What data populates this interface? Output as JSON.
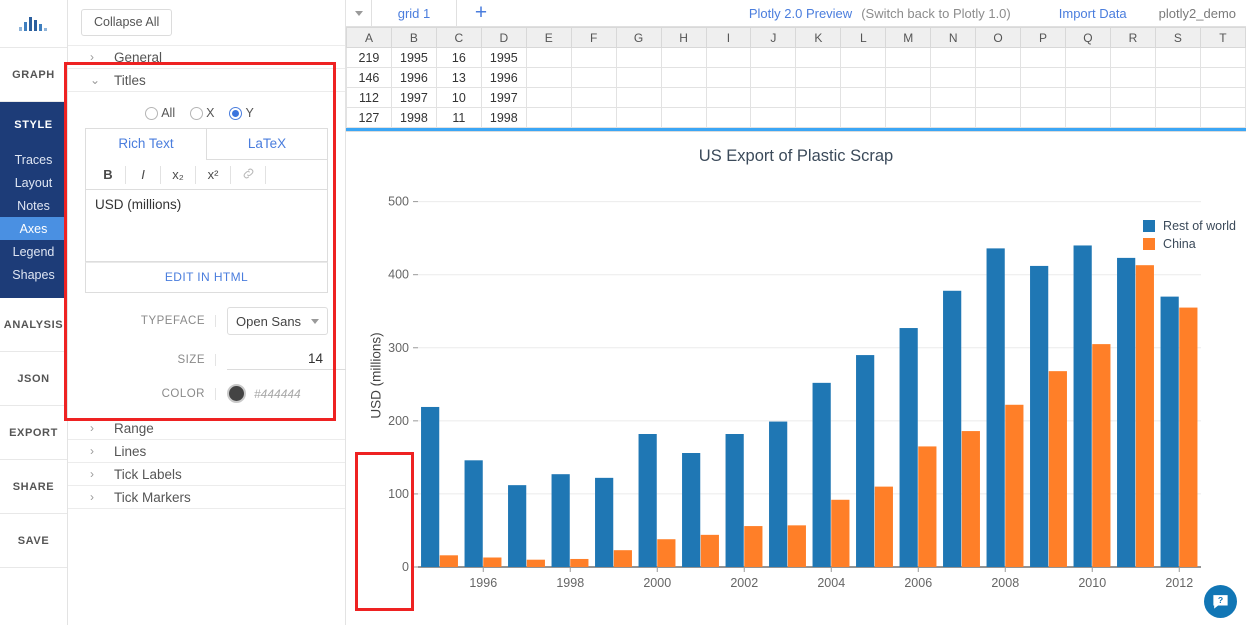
{
  "rail": {
    "logo_icon": "bar-chart-logo-icon",
    "sections": [
      {
        "label": "GRAPH"
      },
      {
        "label": "STYLE"
      },
      {
        "label": "ANALYSIS"
      },
      {
        "label": "JSON"
      },
      {
        "label": "EXPORT"
      },
      {
        "label": "SHARE"
      },
      {
        "label": "SAVE"
      }
    ],
    "style_items": [
      {
        "label": "Traces",
        "active": false
      },
      {
        "label": "Layout",
        "active": false
      },
      {
        "label": "Notes",
        "active": false
      },
      {
        "label": "Axes",
        "active": true
      },
      {
        "label": "Legend",
        "active": false
      },
      {
        "label": "Shapes",
        "active": false
      }
    ]
  },
  "panel": {
    "collapse_all": "Collapse All",
    "sections": [
      {
        "label": "General",
        "expanded": false
      },
      {
        "label": "Titles",
        "expanded": true
      },
      {
        "label": "Range",
        "expanded": false
      },
      {
        "label": "Lines",
        "expanded": false
      },
      {
        "label": "Tick Labels",
        "expanded": false
      },
      {
        "label": "Tick Markers",
        "expanded": false
      }
    ],
    "axis_radios": [
      {
        "label": "All",
        "selected": false
      },
      {
        "label": "X",
        "selected": false
      },
      {
        "label": "Y",
        "selected": true
      }
    ],
    "editor_tabs": [
      {
        "label": "Rich Text",
        "active": true
      },
      {
        "label": "LaTeX",
        "active": false
      }
    ],
    "format_buttons": [
      {
        "icon": "bold-icon",
        "glyph": "B"
      },
      {
        "icon": "italic-icon",
        "glyph": "I"
      },
      {
        "icon": "subscript-icon",
        "glyph": "x₂"
      },
      {
        "icon": "superscript-icon",
        "glyph": "x²"
      },
      {
        "icon": "link-icon",
        "glyph": "🔗"
      }
    ],
    "title_text": "USD (millions)",
    "edit_in_html": "EDIT IN HTML",
    "typeface_label": "TYPEFACE",
    "typeface_value": "Open Sans",
    "size_label": "SIZE",
    "size_value": "14",
    "color_label": "COLOR",
    "color_value": "#444444"
  },
  "topbar": {
    "dropdown_icon": "chevron-down-icon",
    "grid_tab": "grid 1",
    "add_tab_icon": "plus-icon",
    "preview_link": "Plotly 2.0 Preview",
    "switch_back": "(Switch back to Plotly 1.0)",
    "import_data": "Import Data",
    "user": "plotly2_demo"
  },
  "grid": {
    "columns": [
      "A",
      "B",
      "C",
      "D",
      "E",
      "F",
      "G",
      "H",
      "I",
      "J",
      "K",
      "L",
      "M",
      "N",
      "O",
      "P",
      "Q",
      "R",
      "S",
      "T"
    ],
    "rows": [
      [
        "219",
        "1995",
        "16",
        "1995",
        "",
        "",
        "",
        "",
        "",
        "",
        "",
        "",
        "",
        "",
        "",
        "",
        "",
        "",
        "",
        ""
      ],
      [
        "146",
        "1996",
        "13",
        "1996",
        "",
        "",
        "",
        "",
        "",
        "",
        "",
        "",
        "",
        "",
        "",
        "",
        "",
        "",
        "",
        ""
      ],
      [
        "112",
        "1997",
        "10",
        "1997",
        "",
        "",
        "",
        "",
        "",
        "",
        "",
        "",
        "",
        "",
        "",
        "",
        "",
        "",
        "",
        ""
      ],
      [
        "127",
        "1998",
        "11",
        "1998",
        "",
        "",
        "",
        "",
        "",
        "",
        "",
        "",
        "",
        "",
        "",
        "",
        "",
        "",
        "",
        ""
      ]
    ]
  },
  "help_button": {
    "icon": "help-chat-icon",
    "glyph": "?"
  },
  "chart_data": {
    "type": "bar",
    "title": "US Export of Plastic Scrap",
    "xlabel": "",
    "ylabel": "USD (millions)",
    "ylim": [
      0,
      520
    ],
    "yticks": [
      0,
      100,
      200,
      300,
      400,
      500
    ],
    "ytick_labels": [
      "0",
      "100",
      "200",
      "300",
      "400",
      "500"
    ],
    "grid": true,
    "legend_position": "right",
    "categories": [
      1995,
      1996,
      1997,
      1998,
      1999,
      2000,
      2001,
      2002,
      2003,
      2004,
      2005,
      2006,
      2007,
      2008,
      2009,
      2010,
      2011,
      2012
    ],
    "xtick_labels": [
      "1996",
      "1998",
      "2000",
      "2002",
      "2004",
      "2006",
      "2008",
      "2010",
      "2012"
    ],
    "xticks": [
      1996,
      1998,
      2000,
      2002,
      2004,
      2006,
      2008,
      2010,
      2012
    ],
    "series": [
      {
        "name": "Rest of world",
        "color": "#1f77b4",
        "values": [
          219,
          146,
          112,
          127,
          122,
          182,
          156,
          182,
          199,
          252,
          290,
          327,
          378,
          436,
          412,
          440,
          423,
          370
        ]
      },
      {
        "name": "China",
        "color": "#ff7f28",
        "values": [
          16,
          13,
          10,
          11,
          23,
          38,
          44,
          56,
          57,
          92,
          110,
          165,
          186,
          222,
          268,
          305,
          413,
          355
        ]
      }
    ]
  }
}
